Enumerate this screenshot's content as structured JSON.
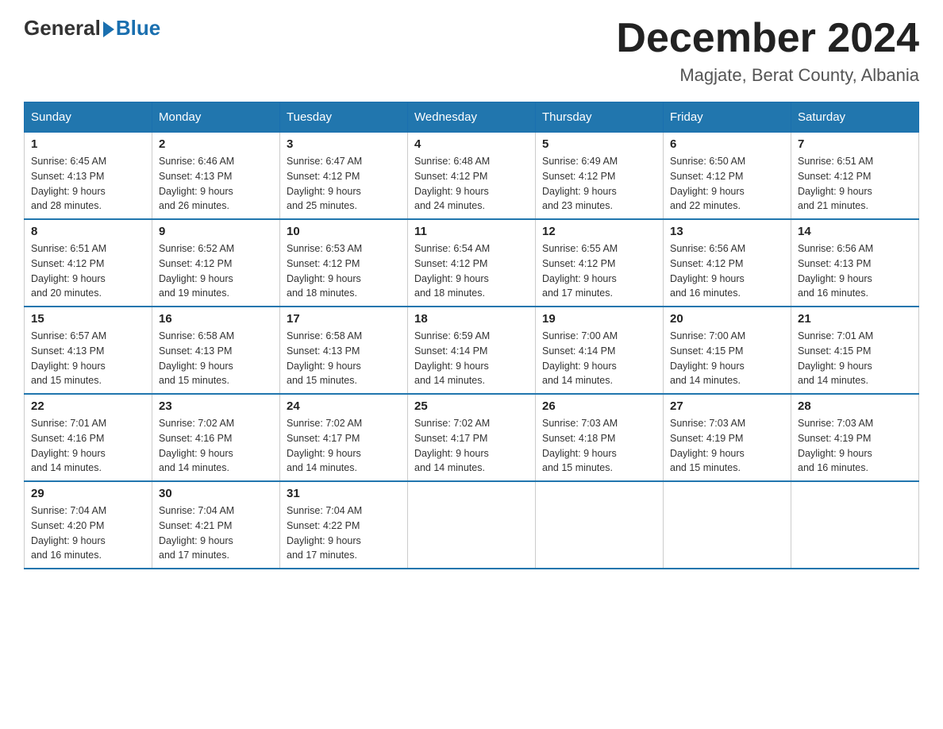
{
  "logo": {
    "general": "General",
    "blue": "Blue"
  },
  "title": "December 2024",
  "subtitle": "Magjate, Berat County, Albania",
  "days_header": [
    "Sunday",
    "Monday",
    "Tuesday",
    "Wednesday",
    "Thursday",
    "Friday",
    "Saturday"
  ],
  "weeks": [
    [
      {
        "day": "1",
        "sunrise": "6:45 AM",
        "sunset": "4:13 PM",
        "daylight": "9 hours and 28 minutes."
      },
      {
        "day": "2",
        "sunrise": "6:46 AM",
        "sunset": "4:13 PM",
        "daylight": "9 hours and 26 minutes."
      },
      {
        "day": "3",
        "sunrise": "6:47 AM",
        "sunset": "4:12 PM",
        "daylight": "9 hours and 25 minutes."
      },
      {
        "day": "4",
        "sunrise": "6:48 AM",
        "sunset": "4:12 PM",
        "daylight": "9 hours and 24 minutes."
      },
      {
        "day": "5",
        "sunrise": "6:49 AM",
        "sunset": "4:12 PM",
        "daylight": "9 hours and 23 minutes."
      },
      {
        "day": "6",
        "sunrise": "6:50 AM",
        "sunset": "4:12 PM",
        "daylight": "9 hours and 22 minutes."
      },
      {
        "day": "7",
        "sunrise": "6:51 AM",
        "sunset": "4:12 PM",
        "daylight": "9 hours and 21 minutes."
      }
    ],
    [
      {
        "day": "8",
        "sunrise": "6:51 AM",
        "sunset": "4:12 PM",
        "daylight": "9 hours and 20 minutes."
      },
      {
        "day": "9",
        "sunrise": "6:52 AM",
        "sunset": "4:12 PM",
        "daylight": "9 hours and 19 minutes."
      },
      {
        "day": "10",
        "sunrise": "6:53 AM",
        "sunset": "4:12 PM",
        "daylight": "9 hours and 18 minutes."
      },
      {
        "day": "11",
        "sunrise": "6:54 AM",
        "sunset": "4:12 PM",
        "daylight": "9 hours and 18 minutes."
      },
      {
        "day": "12",
        "sunrise": "6:55 AM",
        "sunset": "4:12 PM",
        "daylight": "9 hours and 17 minutes."
      },
      {
        "day": "13",
        "sunrise": "6:56 AM",
        "sunset": "4:12 PM",
        "daylight": "9 hours and 16 minutes."
      },
      {
        "day": "14",
        "sunrise": "6:56 AM",
        "sunset": "4:13 PM",
        "daylight": "9 hours and 16 minutes."
      }
    ],
    [
      {
        "day": "15",
        "sunrise": "6:57 AM",
        "sunset": "4:13 PM",
        "daylight": "9 hours and 15 minutes."
      },
      {
        "day": "16",
        "sunrise": "6:58 AM",
        "sunset": "4:13 PM",
        "daylight": "9 hours and 15 minutes."
      },
      {
        "day": "17",
        "sunrise": "6:58 AM",
        "sunset": "4:13 PM",
        "daylight": "9 hours and 15 minutes."
      },
      {
        "day": "18",
        "sunrise": "6:59 AM",
        "sunset": "4:14 PM",
        "daylight": "9 hours and 14 minutes."
      },
      {
        "day": "19",
        "sunrise": "7:00 AM",
        "sunset": "4:14 PM",
        "daylight": "9 hours and 14 minutes."
      },
      {
        "day": "20",
        "sunrise": "7:00 AM",
        "sunset": "4:15 PM",
        "daylight": "9 hours and 14 minutes."
      },
      {
        "day": "21",
        "sunrise": "7:01 AM",
        "sunset": "4:15 PM",
        "daylight": "9 hours and 14 minutes."
      }
    ],
    [
      {
        "day": "22",
        "sunrise": "7:01 AM",
        "sunset": "4:16 PM",
        "daylight": "9 hours and 14 minutes."
      },
      {
        "day": "23",
        "sunrise": "7:02 AM",
        "sunset": "4:16 PM",
        "daylight": "9 hours and 14 minutes."
      },
      {
        "day": "24",
        "sunrise": "7:02 AM",
        "sunset": "4:17 PM",
        "daylight": "9 hours and 14 minutes."
      },
      {
        "day": "25",
        "sunrise": "7:02 AM",
        "sunset": "4:17 PM",
        "daylight": "9 hours and 14 minutes."
      },
      {
        "day": "26",
        "sunrise": "7:03 AM",
        "sunset": "4:18 PM",
        "daylight": "9 hours and 15 minutes."
      },
      {
        "day": "27",
        "sunrise": "7:03 AM",
        "sunset": "4:19 PM",
        "daylight": "9 hours and 15 minutes."
      },
      {
        "day": "28",
        "sunrise": "7:03 AM",
        "sunset": "4:19 PM",
        "daylight": "9 hours and 16 minutes."
      }
    ],
    [
      {
        "day": "29",
        "sunrise": "7:04 AM",
        "sunset": "4:20 PM",
        "daylight": "9 hours and 16 minutes."
      },
      {
        "day": "30",
        "sunrise": "7:04 AM",
        "sunset": "4:21 PM",
        "daylight": "9 hours and 17 minutes."
      },
      {
        "day": "31",
        "sunrise": "7:04 AM",
        "sunset": "4:22 PM",
        "daylight": "9 hours and 17 minutes."
      },
      null,
      null,
      null,
      null
    ]
  ],
  "labels": {
    "sunrise": "Sunrise:",
    "sunset": "Sunset:",
    "daylight": "Daylight:"
  }
}
